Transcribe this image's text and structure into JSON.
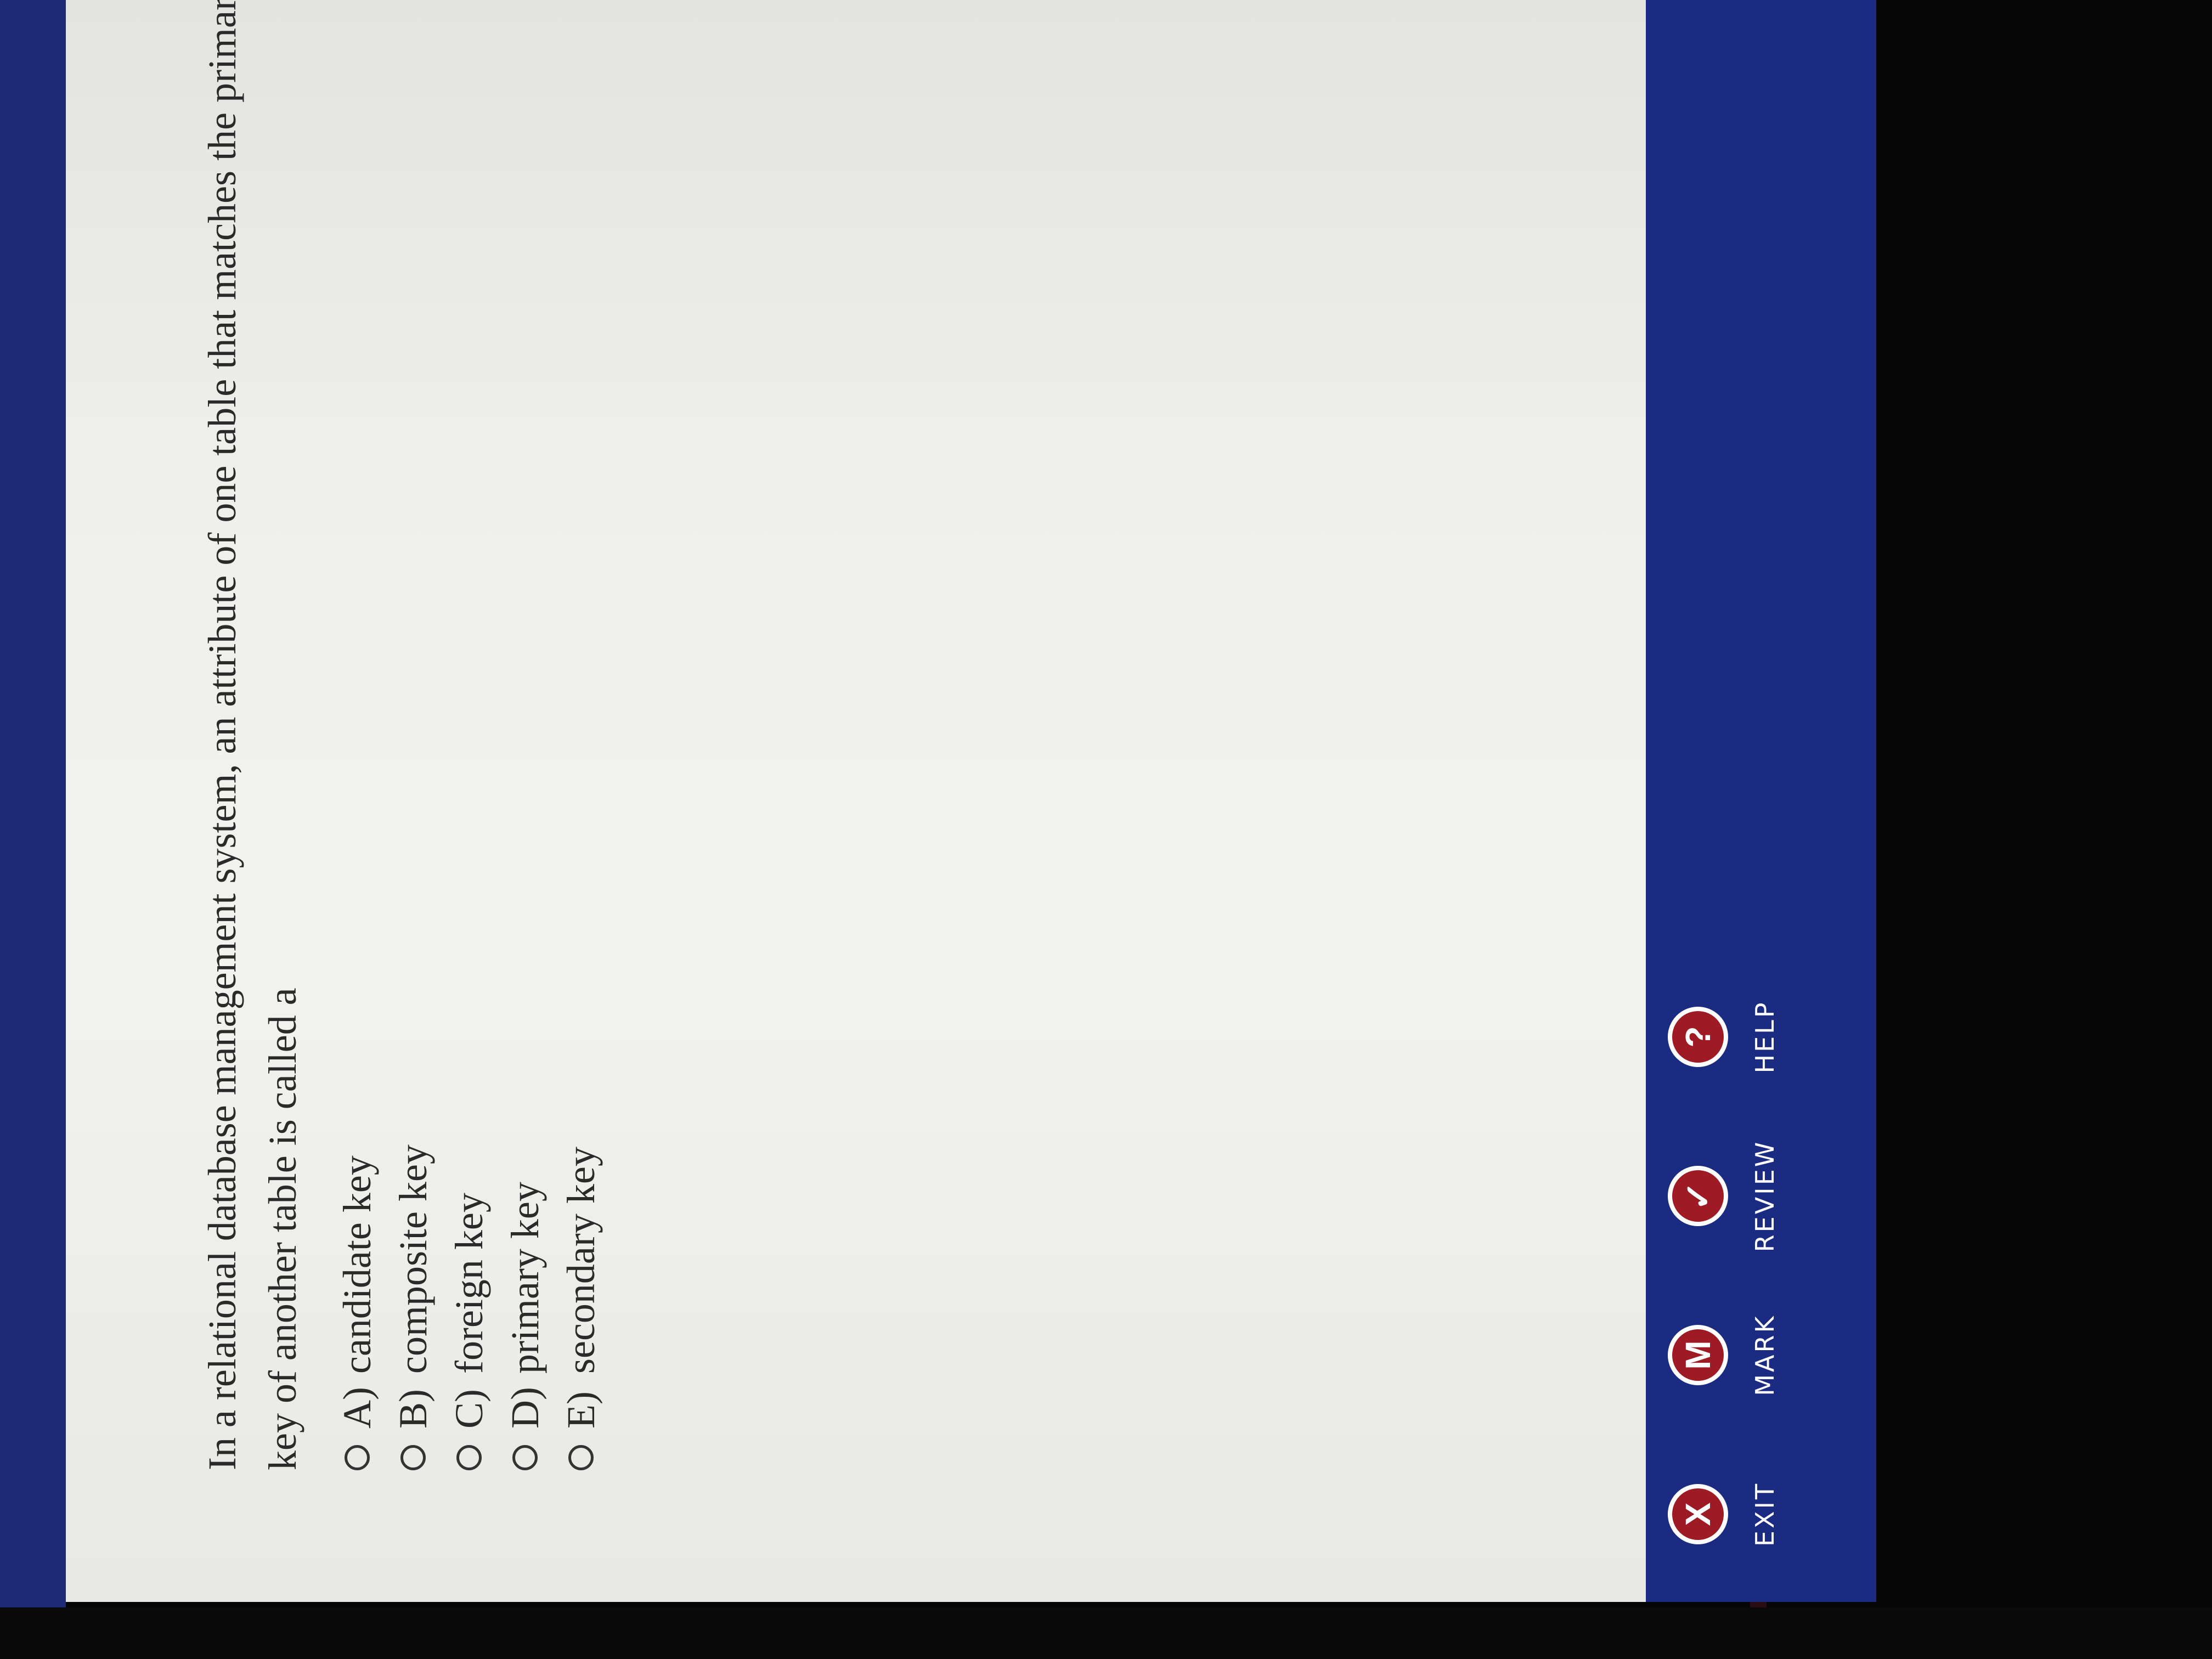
{
  "question": {
    "text": "In a relational database management system, an attribute of one table that matches the primary key of another table is called a"
  },
  "choices": [
    {
      "letter": "A)",
      "text": "candidate key"
    },
    {
      "letter": "B)",
      "text": "composite key"
    },
    {
      "letter": "C)",
      "text": "foreign key"
    },
    {
      "letter": "D)",
      "text": "primary key"
    },
    {
      "letter": "E)",
      "text": "secondary key"
    }
  ],
  "toolbar": {
    "exit": {
      "glyph": "X",
      "label": "EXIT"
    },
    "mark": {
      "glyph": "M",
      "label": "MARK"
    },
    "review": {
      "glyph": "✓",
      "label": "REVIEW"
    },
    "help": {
      "glyph": "?",
      "label": "HELP"
    }
  },
  "colors": {
    "frame": "#1c2b82",
    "button": "#9e1a24",
    "page": "#efefeb"
  }
}
